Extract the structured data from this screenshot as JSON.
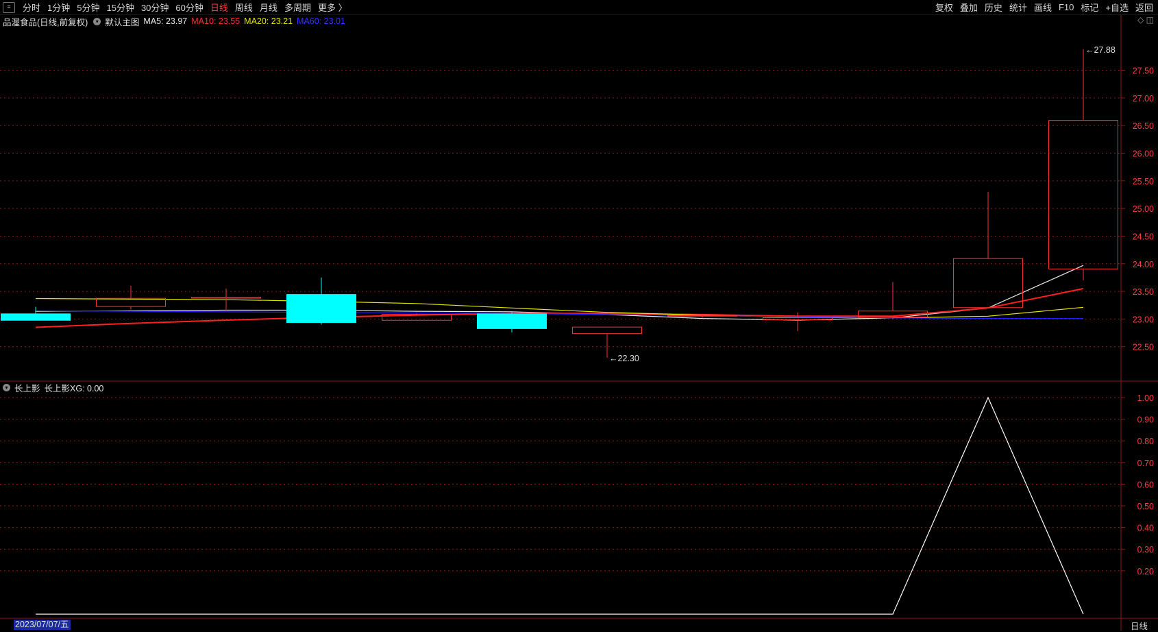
{
  "toolbar": {
    "left_items": [
      {
        "label": "分时",
        "active": false
      },
      {
        "label": "1分钟",
        "active": false
      },
      {
        "label": "5分钟",
        "active": false
      },
      {
        "label": "15分钟",
        "active": false
      },
      {
        "label": "30分钟",
        "active": false
      },
      {
        "label": "60分钟",
        "active": false
      },
      {
        "label": "日线",
        "active": true
      },
      {
        "label": "周线",
        "active": false
      },
      {
        "label": "月线",
        "active": false
      },
      {
        "label": "多周期",
        "active": false
      },
      {
        "label": "更多 〉",
        "active": false
      }
    ],
    "right_items": [
      "复权",
      "叠加",
      "历史",
      "统计",
      "画线",
      "F10",
      "标记",
      "+自选",
      "返回"
    ]
  },
  "main_info": {
    "stock": "品渥食品(日线,前复权)",
    "template": "默认主图",
    "ma5": "MA5: 23.97",
    "ma10": "MA10: 23.55",
    "ma20": "MA20: 23.21",
    "ma60": "MA60: 23.01"
  },
  "indicator_info": {
    "name": "长上影",
    "value": "长上影XG: 0.00"
  },
  "footer": {
    "date": "2023/07/07/五",
    "period": "日线"
  },
  "colors": {
    "up": "#ff3232",
    "down": "#00ffff",
    "ma5": "#e8e8e8",
    "ma10": "#ff2020",
    "ma20": "#e6e600",
    "ma60": "#2020ff",
    "grid": "#8b1a1a",
    "axis_text": "#ff3c3c",
    "indicator": "#ffffff"
  },
  "chart_data": [
    {
      "type": "candlestick",
      "title": "品渥食品(日线,前复权)",
      "yticks": [
        22.5,
        23.0,
        23.5,
        24.0,
        24.5,
        25.0,
        25.5,
        26.0,
        26.5,
        27.0,
        27.5
      ],
      "ylim": [
        22.0,
        28.4
      ],
      "candles": [
        {
          "open": 23.1,
          "close": 22.97,
          "high": 23.22,
          "low": 22.97
        },
        {
          "open": 23.22,
          "close": 23.38,
          "high": 23.6,
          "low": 23.17
        },
        {
          "open": 23.37,
          "close": 23.4,
          "high": 23.55,
          "low": 23.16
        },
        {
          "open": 23.45,
          "close": 22.93,
          "high": 23.75,
          "low": 22.9
        },
        {
          "open": 22.97,
          "close": 23.09,
          "high": 23.11,
          "low": 22.97
        },
        {
          "open": 23.1,
          "close": 22.82,
          "high": 23.13,
          "low": 22.76
        },
        {
          "open": 22.73,
          "close": 22.86,
          "high": 22.86,
          "low": 22.3
        },
        {
          "open": 23.05,
          "close": 23.07,
          "high": 23.09,
          "low": 23.02
        },
        {
          "open": 22.98,
          "close": 23.03,
          "high": 23.12,
          "low": 22.78
        },
        {
          "open": 23.03,
          "close": 23.15,
          "high": 23.67,
          "low": 23.0
        },
        {
          "open": 23.2,
          "close": 24.1,
          "high": 25.3,
          "low": 23.2
        },
        {
          "open": 23.9,
          "close": 26.6,
          "high": 27.88,
          "low": 23.7
        }
      ],
      "annotations": [
        {
          "text": "27.88",
          "candle": 11,
          "price": 27.88
        },
        {
          "text": "22.30",
          "candle": 6,
          "price": 22.3
        }
      ],
      "series": [
        {
          "name": "MA5",
          "values": [
            23.14,
            23.15,
            23.16,
            23.16,
            23.14,
            23.13,
            23.08,
            23.01,
            22.98,
            23.02,
            23.2,
            23.97
          ]
        },
        {
          "name": "MA10",
          "values": [
            22.85,
            22.92,
            22.98,
            23.03,
            23.07,
            23.1,
            23.1,
            23.08,
            23.05,
            23.05,
            23.2,
            23.55
          ]
        },
        {
          "name": "MA20",
          "values": [
            23.37,
            23.36,
            23.35,
            23.32,
            23.28,
            23.2,
            23.12,
            23.07,
            23.03,
            23.02,
            23.05,
            23.21
          ]
        },
        {
          "name": "MA60",
          "values": [
            23.15,
            23.14,
            23.13,
            23.12,
            23.11,
            23.1,
            23.08,
            23.06,
            23.04,
            23.02,
            23.01,
            23.01
          ]
        }
      ]
    },
    {
      "type": "line",
      "title": "长上影",
      "yticks": [
        0.2,
        0.3,
        0.4,
        0.5,
        0.6,
        0.7,
        0.8,
        0.9,
        1.0
      ],
      "ylim": [
        0,
        1.0
      ],
      "series": [
        {
          "name": "长上影XG",
          "values": [
            0,
            0,
            0,
            0,
            0,
            0,
            0,
            0,
            0,
            0,
            1,
            0
          ]
        }
      ]
    }
  ]
}
